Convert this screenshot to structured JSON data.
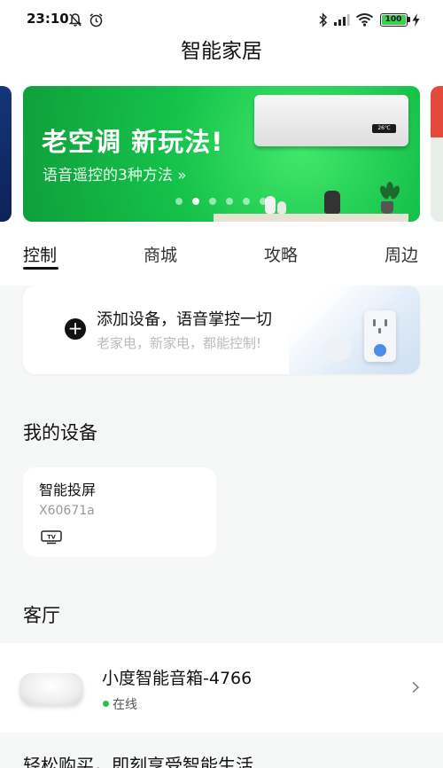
{
  "status_bar": {
    "time": "23:10",
    "battery": "100",
    "icons": [
      "bell-off-icon",
      "alarm-icon",
      "bluetooth-icon",
      "signal-icon",
      "wifi-icon",
      "battery-icon",
      "charging-icon"
    ]
  },
  "header": {
    "title": "智能家居"
  },
  "banner": {
    "headline": "老空调 新玩法!",
    "subline": "语音遥控的3种方法 »",
    "ac_display": "26℃",
    "dots_count": 6,
    "active_dot": 1
  },
  "tabs": [
    {
      "label": "控制",
      "active": true
    },
    {
      "label": "商城",
      "active": false
    },
    {
      "label": "攻略",
      "active": false
    },
    {
      "label": "周边",
      "active": false
    }
  ],
  "add_device": {
    "title": "添加设备，语音掌控一切",
    "subtitle": "老家电，新家电，都能控制!",
    "plus_symbol": "+"
  },
  "my_devices": {
    "section_title": "我的设备",
    "devices": [
      {
        "name": "智能投屏",
        "id": "X60671a",
        "icon": "tv-icon"
      }
    ]
  },
  "living_room": {
    "section_title": "客厅",
    "devices": [
      {
        "name": "小度智能音箱-4766",
        "status": "在线",
        "status_color": "#2cbf4b"
      }
    ]
  },
  "bottom_section": {
    "title": "轻松购买，即刻享受智能生活"
  },
  "colors": {
    "banner_green": "#15c24a",
    "accent_blue": "#4d8de8",
    "online_green": "#2cbf4b"
  }
}
